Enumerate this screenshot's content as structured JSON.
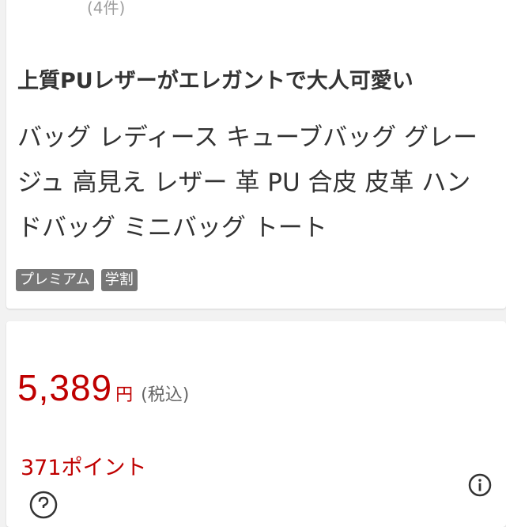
{
  "review": {
    "count_text": "(4件)"
  },
  "product": {
    "catchcopy": "上質PUレザーがエレガントで大人可愛い",
    "name": "バッグ レディース キューブバッグ グレージュ 高見え レザー 革 PU 合皮 皮革 ハンドバッグ ミニバッグ トート",
    "tags": [
      "プレミアム",
      "学割"
    ]
  },
  "price": {
    "value": "5,389",
    "unit": "円",
    "tax_note": "(税込)"
  },
  "points": {
    "text": "371ポイント"
  },
  "icons": {
    "info": "info-icon",
    "help": "help-icon"
  },
  "colors": {
    "price": "#bf0000",
    "tag_bg": "#777777",
    "background": "#f2f2f2"
  }
}
